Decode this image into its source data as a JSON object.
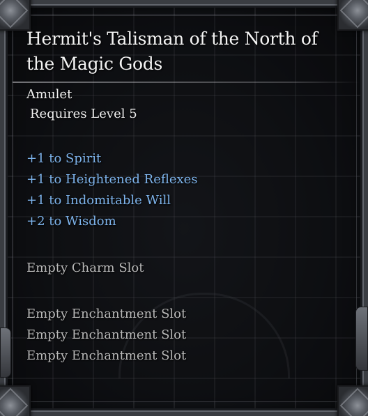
{
  "item": {
    "name": "Hermit's Talisman of the North of the Magic Gods",
    "type": "Amulet",
    "requirement": "Requires Level 5"
  },
  "stats": [
    "+1 to Spirit",
    "+1 to Heightened Reflexes",
    "+1 to Indomitable Will",
    "+2 to Wisdom"
  ],
  "slots": {
    "charm": "Empty Charm Slot",
    "enchantments": [
      "Empty Enchantment Slot",
      "Empty Enchantment Slot",
      "Empty Enchantment Slot"
    ]
  },
  "colors": {
    "name": "#f4f4f4",
    "stat_bonus": "#7eb4ec",
    "empty_slot": "#b9b9b9"
  }
}
